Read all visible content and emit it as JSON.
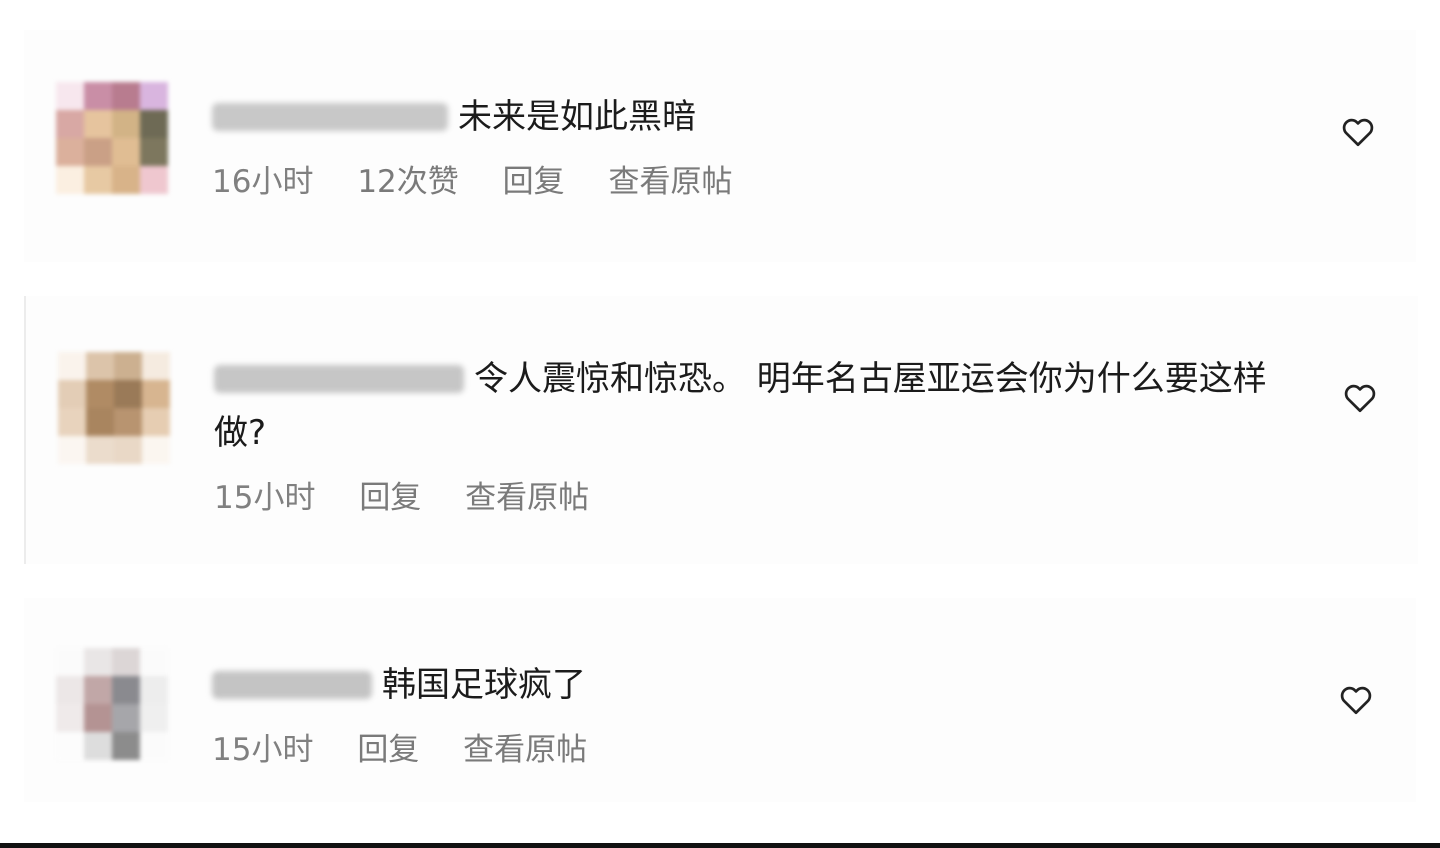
{
  "comments": [
    {
      "text": "未来是如此黑暗",
      "time": "16小时",
      "likes": "12次赞",
      "reply": "回复",
      "view_original": "查看原帖",
      "like_icon": "heart-outline-icon"
    },
    {
      "text": "令人震惊和惊恐。 明年名古屋亚运会你为什么要这样做?",
      "time": "15小时",
      "reply": "回复",
      "view_original": "查看原帖",
      "like_icon": "heart-outline-icon"
    },
    {
      "text": "韩国足球疯了",
      "time": "15小时",
      "reply": "回复",
      "view_original": "查看原帖",
      "like_icon": "heart-outline-icon"
    }
  ],
  "colors": {
    "text": "#1b1b1b",
    "meta": "#808080",
    "background": "#ffffff"
  }
}
